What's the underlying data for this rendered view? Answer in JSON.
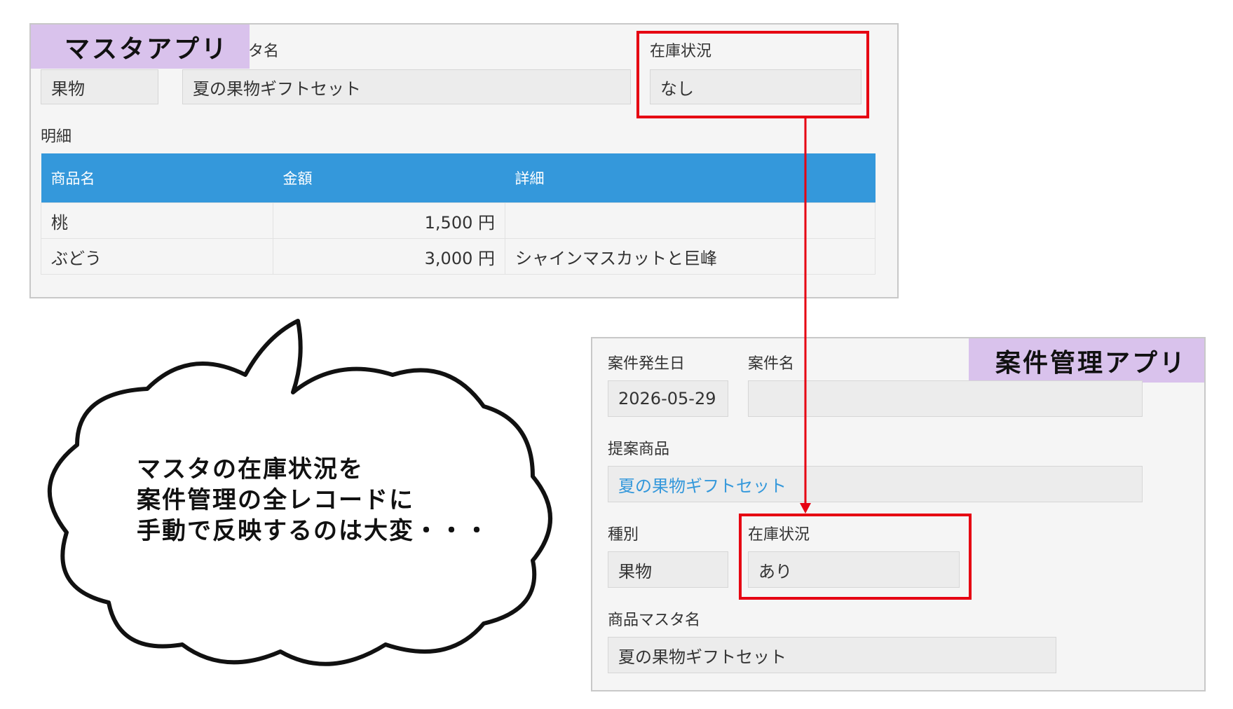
{
  "master_app": {
    "tag": "マスタアプリ",
    "master_name_label": "タ名",
    "category_value": "果物",
    "name_value": "夏の果物ギフトセット",
    "stock_label": "在庫状況",
    "stock_value": "なし",
    "detail_label": "明細",
    "table": {
      "headers": [
        "商品名",
        "金額",
        "詳細"
      ],
      "rows": [
        [
          "桃",
          "1,500 円",
          ""
        ],
        [
          "ぶどう",
          "3,000 円",
          "シャインマスカットと巨峰"
        ]
      ]
    }
  },
  "case_app": {
    "tag": "案件管理アプリ",
    "date_label": "案件発生日",
    "date_value": "2026-05-29",
    "case_name_label": "案件名",
    "case_name_value": "",
    "product_label": "提案商品",
    "product_value": "夏の果物ギフトセット",
    "category_label": "種別",
    "category_value": "果物",
    "stock_label": "在庫状況",
    "stock_value": "あり",
    "master_name_label": "商品マスタ名",
    "master_name_value": "夏の果物ギフトセット"
  },
  "speech_bubble": {
    "lines": [
      "マスタの在庫状況を",
      "案件管理の全レコードに",
      "手動で反映するのは大変・・・"
    ]
  },
  "colors": {
    "highlight": "#e60012",
    "table_header": "#3498db",
    "app_tag": "#d9c2ec",
    "link": "#3498db"
  }
}
